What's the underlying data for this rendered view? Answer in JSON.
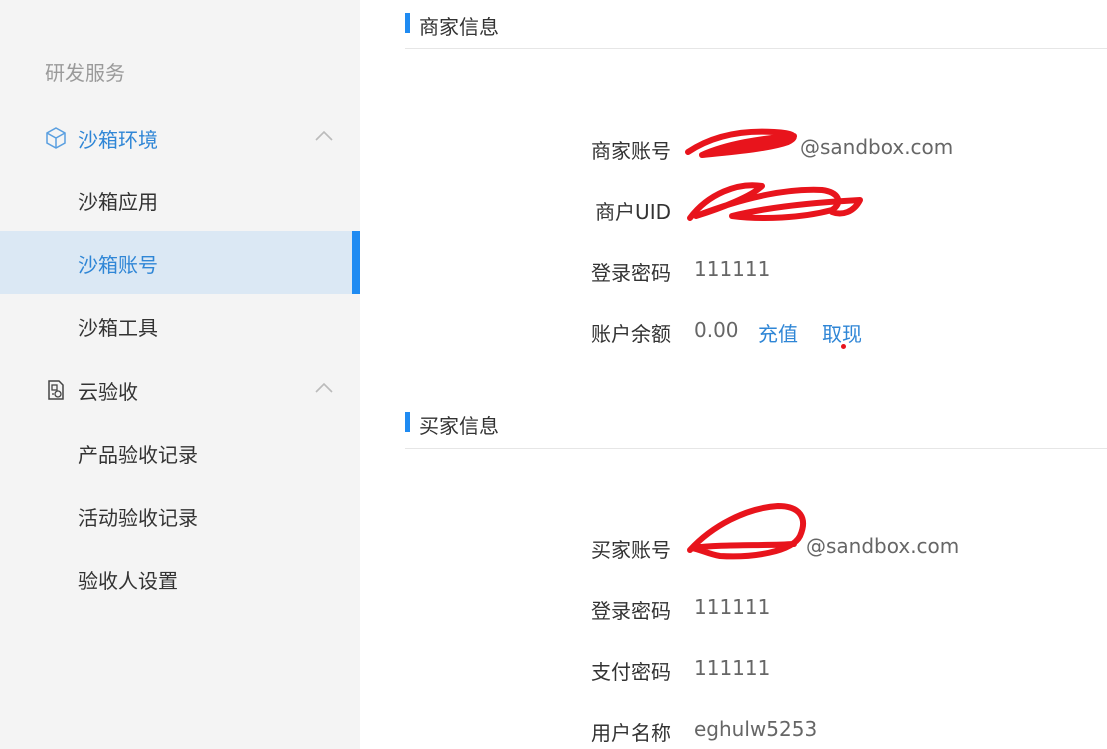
{
  "sidebar": {
    "section_label": "研发服务",
    "groups": [
      {
        "label": "沙箱环境",
        "icon": "cube-icon",
        "expanded": true,
        "items": [
          {
            "label": "沙箱应用",
            "active": false
          },
          {
            "label": "沙箱账号",
            "active": true
          },
          {
            "label": "沙箱工具",
            "active": false
          }
        ]
      },
      {
        "label": "云验收",
        "icon": "document-check-icon",
        "expanded": true,
        "items": [
          {
            "label": "产品验收记录",
            "active": false
          },
          {
            "label": "活动验收记录",
            "active": false
          },
          {
            "label": "验收人设置",
            "active": false
          }
        ]
      }
    ]
  },
  "merchant": {
    "title": "商家信息",
    "account_label": "商家账号",
    "account_value": "@sandbox.com",
    "uid_label": "商户UID",
    "uid_value": "",
    "password_label": "登录密码",
    "password_value": "111111",
    "balance_label": "账户余额",
    "balance_value": "0.00",
    "recharge": "充值",
    "withdraw": "取现"
  },
  "buyer": {
    "title": "买家信息",
    "account_label": "买家账号",
    "account_value": "@sandbox.com",
    "password_label": "登录密码",
    "password_value": "111111",
    "pay_password_label": "支付密码",
    "pay_password_value": "111111",
    "username_label": "用户名称",
    "username_value": "eghulw5253"
  },
  "colors": {
    "accent": "#1f8bf2",
    "link": "#2f86d6",
    "sidebar_bg": "#f4f4f4",
    "active_bg": "#dbe8f4",
    "redaction": "#e8141c"
  }
}
